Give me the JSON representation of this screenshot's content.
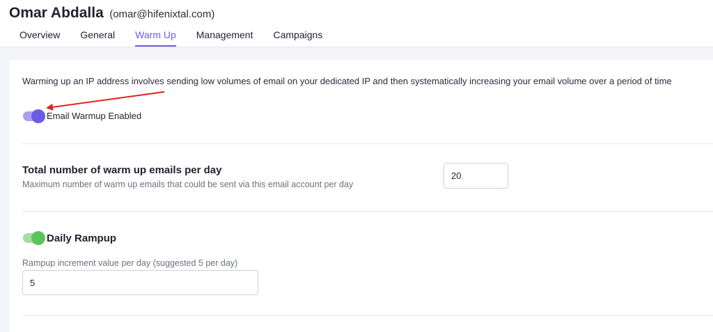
{
  "header": {
    "name": "Omar Abdalla",
    "email": "(omar@hifenixtal.com)",
    "tabs": [
      {
        "label": "Overview",
        "active": false
      },
      {
        "label": "General",
        "active": false
      },
      {
        "label": "Warm Up",
        "active": true
      },
      {
        "label": "Management",
        "active": false
      },
      {
        "label": "Campaigns",
        "active": false
      }
    ]
  },
  "warmup": {
    "intro": "Warming up an IP address involves sending low volumes of email on your dedicated IP and then systematically increasing your email volume over a period of time",
    "enabled_label": "Email Warmup Enabled",
    "enabled": true,
    "emails_per_day": {
      "title": "Total number of warm up emails per day",
      "description": "Maximum number of warm up emails that could be sent via this email account per day",
      "value": "20"
    },
    "rampup": {
      "label": "Daily Rampup",
      "enabled": true,
      "increment_label": "Rampup increment value per day (suggested 5 per day)",
      "increment_value": "5"
    }
  },
  "colors": {
    "accent": "#6b5ce7",
    "toggle_on_green": "#5cc45a",
    "annotation_arrow": "#e02020"
  }
}
